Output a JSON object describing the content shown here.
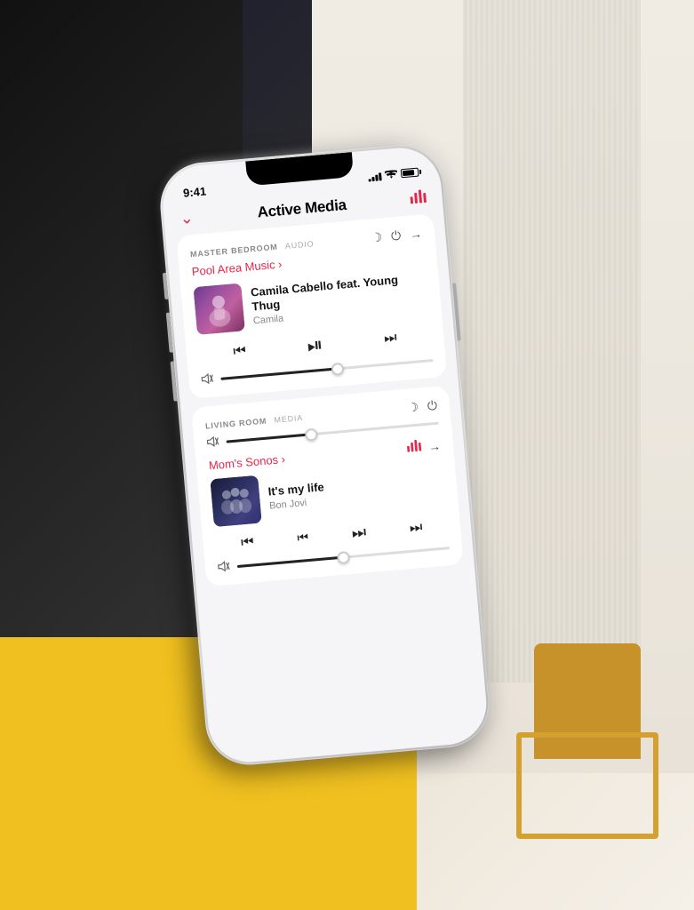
{
  "background": {
    "desc": "Modern interior room with curtains and gold chair"
  },
  "phone": {
    "status_bar": {
      "time": "9:41",
      "signal": "signal",
      "wifi": "wifi",
      "battery": "battery"
    },
    "header": {
      "chevron": "˅",
      "title": "Active Media",
      "chart_icon": "chart"
    },
    "cards": [
      {
        "id": "master-bedroom",
        "room_label": "MASTER BEDROOM",
        "room_type": "AUDIO",
        "source_link": "Pool Area Music ›",
        "track_title": "Camila Cabello feat. Young Thug",
        "track_album": "Camila",
        "slider_fill_pct": 55,
        "slider_thumb_pct": 55
      },
      {
        "id": "living-room",
        "room_label": "LIVING ROOM",
        "room_type": "MEDIA",
        "source_link": "Mom's Sonos ›",
        "track_title": "It's my life",
        "track_album": "Bon Jovi",
        "slider_fill_pct": 45,
        "slider_thumb_pct": 45
      }
    ],
    "controls": {
      "moon": "☽",
      "power": "⏻",
      "arrow": "→",
      "prev_prev": "⏮",
      "prev": "⏮",
      "play_pause": "⏯",
      "next": "⏭",
      "next_next": "⏭",
      "mute": "🔇"
    }
  }
}
